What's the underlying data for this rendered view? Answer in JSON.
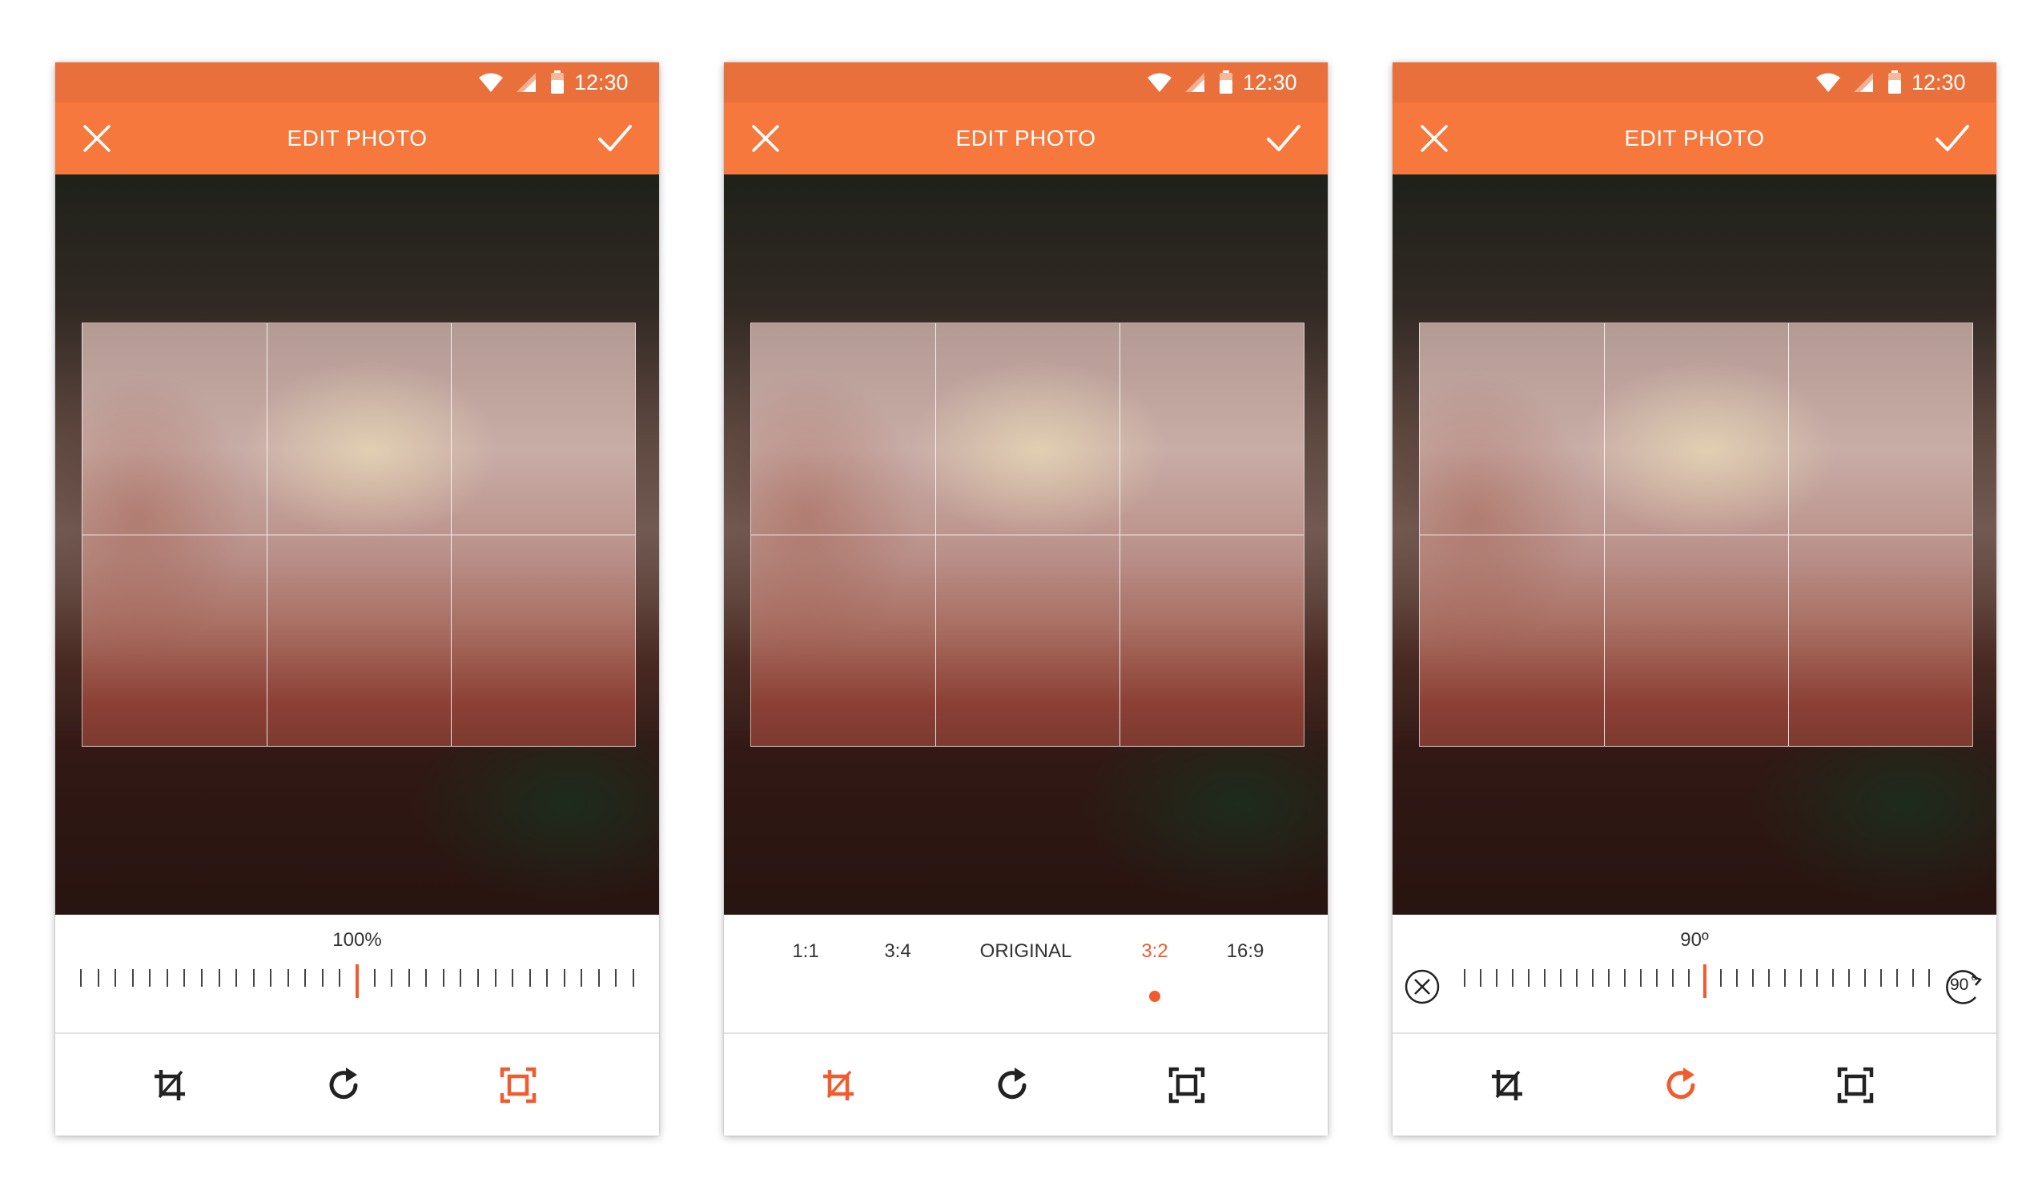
{
  "colors": {
    "accent": "#f25b2d",
    "appbar": "#f6783c",
    "statusbar": "#e9703a",
    "icon_default": "#222222"
  },
  "screens": [
    {
      "status": {
        "time": "12:30"
      },
      "appbar": {
        "title": "EDIT PHOTO",
        "close_icon": "close-icon",
        "confirm_icon": "check-icon"
      },
      "panel": {
        "mode": "scale",
        "value_label": "100%",
        "slider_level": 0.5
      },
      "toolbar": {
        "active": "frame",
        "items": [
          "crop-icon",
          "rotate-icon",
          "frame-icon"
        ]
      }
    },
    {
      "status": {
        "time": "12:30"
      },
      "appbar": {
        "title": "EDIT PHOTO",
        "close_icon": "close-icon",
        "confirm_icon": "check-icon"
      },
      "panel": {
        "mode": "ratio",
        "ratios": [
          "1:1",
          "3:4",
          "ORIGINAL",
          "3:2",
          "16:9"
        ],
        "selected_ratio": "3:2"
      },
      "toolbar": {
        "active": "crop",
        "items": [
          "crop-icon",
          "rotate-icon",
          "frame-icon"
        ]
      }
    },
    {
      "status": {
        "time": "12:30"
      },
      "appbar": {
        "title": "EDIT PHOTO",
        "close_icon": "close-icon",
        "confirm_icon": "check-icon"
      },
      "panel": {
        "mode": "rotate",
        "value_label": "90º",
        "rotate_button_label": "90",
        "rotate_button_suffix": "º",
        "slider_level": 0.5
      },
      "toolbar": {
        "active": "rotate",
        "items": [
          "crop-icon",
          "rotate-icon",
          "frame-icon"
        ]
      }
    }
  ]
}
